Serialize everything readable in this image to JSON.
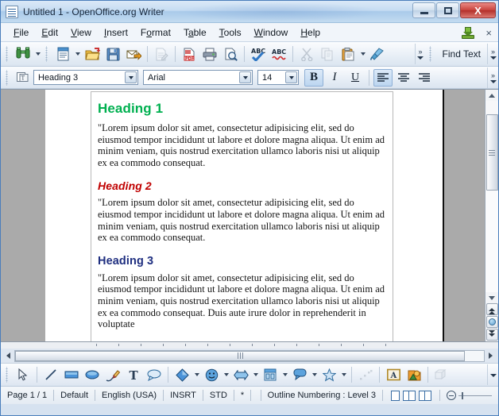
{
  "window": {
    "title": "Untitled 1 - OpenOffice.org Writer",
    "icon": "writer-document-icon",
    "minimize_label": "Minimize",
    "maximize_label": "Maximize",
    "close_label": "X"
  },
  "menubar": {
    "items": [
      {
        "label": "File",
        "accel": "F"
      },
      {
        "label": "Edit",
        "accel": "E"
      },
      {
        "label": "View",
        "accel": "V"
      },
      {
        "label": "Insert",
        "accel": "I"
      },
      {
        "label": "Format",
        "accel": "o"
      },
      {
        "label": "Table",
        "accel": "a"
      },
      {
        "label": "Tools",
        "accel": "T"
      },
      {
        "label": "Window",
        "accel": "W"
      },
      {
        "label": "Help",
        "accel": "H"
      }
    ],
    "right_icons": [
      "download-update-icon",
      "close-document-icon"
    ],
    "close_doc_label": "×"
  },
  "standard_toolbar": {
    "buttons": [
      {
        "name": "binoculars-icon",
        "tooltip": "Find & Replace"
      },
      {
        "name": "new-document-icon",
        "tooltip": "New"
      },
      {
        "name": "open-folder-icon",
        "tooltip": "Open"
      },
      {
        "name": "save-floppy-icon",
        "tooltip": "Save"
      },
      {
        "name": "email-document-icon",
        "tooltip": "E-mail Document"
      },
      {
        "name": "edit-file-icon",
        "tooltip": "Edit File"
      },
      {
        "name": "export-pdf-icon",
        "tooltip": "Export as PDF"
      },
      {
        "name": "print-icon",
        "tooltip": "Print File Directly"
      },
      {
        "name": "print-preview-icon",
        "tooltip": "Page Preview"
      },
      {
        "name": "spelling-icon",
        "tooltip": "Spelling and Grammar"
      },
      {
        "name": "autospellcheck-icon",
        "tooltip": "AutoSpellcheck"
      },
      {
        "name": "cut-scissors-icon",
        "tooltip": "Cut"
      },
      {
        "name": "copy-icon",
        "tooltip": "Copy"
      },
      {
        "name": "paste-clipboard-icon",
        "tooltip": "Paste"
      },
      {
        "name": "clone-formatting-icon",
        "tooltip": "Clone Formatting"
      }
    ],
    "overflow_label": "»",
    "find_text_label": "Find Text"
  },
  "formatting_toolbar": {
    "apply_style_icon": "apply-style-icon",
    "paragraph_style": {
      "value": "Heading 3",
      "placeholder": "Paragraph Style"
    },
    "font_name": {
      "value": "Arial",
      "placeholder": "Font Name"
    },
    "font_size": {
      "value": "14",
      "placeholder": "Font Size"
    },
    "bold": {
      "label": "B",
      "pressed": true
    },
    "italic": {
      "label": "I",
      "pressed": false
    },
    "underline": {
      "label": "U",
      "pressed": false
    },
    "align_left": {
      "name": "align-left-icon",
      "pressed": true
    },
    "align_center": {
      "name": "align-center-icon",
      "pressed": false
    },
    "align_right": {
      "name": "align-right-icon",
      "pressed": false
    },
    "overflow_label": "»"
  },
  "document": {
    "blocks": [
      {
        "heading": "Heading 1",
        "heading_color": "#00b050",
        "body": "\"Lorem ipsum dolor sit amet, consectetur adipisicing elit, sed do eiusmod tempor incididunt ut labore et dolore magna aliqua. Ut enim ad minim veniam, quis nostrud exercitation ullamco laboris nisi ut aliquip ex ea commodo consequat."
      },
      {
        "heading": "Heading 2",
        "heading_color": "#c00000",
        "body": "\"Lorem ipsum dolor sit amet, consectetur adipisicing elit, sed do eiusmod tempor incididunt ut labore et dolore magna aliqua. Ut enim ad minim veniam, quis nostrud exercitation ullamco laboris nisi ut aliquip ex ea commodo consequat."
      },
      {
        "heading": "Heading 3",
        "heading_color": "#1f2f80",
        "body": "\"Lorem ipsum dolor sit amet, consectetur adipisicing elit, sed do eiusmod tempor incididunt ut labore et dolore magna aliqua. Ut enim ad minim veniam, quis nostrud exercitation ullamco laboris nisi ut aliquip ex ea commodo consequat. Duis aute irure dolor in reprehenderit in voluptate"
      }
    ]
  },
  "drawing_toolbar": {
    "buttons": [
      {
        "name": "select-arrow-icon",
        "tooltip": "Select"
      },
      {
        "name": "line-icon",
        "tooltip": "Line"
      },
      {
        "name": "rectangle-icon",
        "tooltip": "Rectangle"
      },
      {
        "name": "ellipse-icon",
        "tooltip": "Ellipse"
      },
      {
        "name": "freeform-line-icon",
        "tooltip": "Freeform Line"
      },
      {
        "name": "text-box-icon",
        "tooltip": "Text Box"
      },
      {
        "name": "callout-icon",
        "tooltip": "Callouts"
      },
      {
        "name": "basic-shapes-icon",
        "tooltip": "Basic Shapes"
      },
      {
        "name": "symbol-shapes-icon",
        "tooltip": "Symbol Shapes"
      },
      {
        "name": "block-arrows-icon",
        "tooltip": "Block Arrows"
      },
      {
        "name": "flowchart-icon",
        "tooltip": "Flowchart"
      },
      {
        "name": "callout-shapes-icon",
        "tooltip": "Callout Shapes"
      },
      {
        "name": "stars-icon",
        "tooltip": "Stars"
      },
      {
        "name": "points-icon",
        "tooltip": "Points"
      },
      {
        "name": "fontwork-icon",
        "tooltip": "Fontwork Gallery"
      },
      {
        "name": "from-file-icon",
        "tooltip": "From File"
      },
      {
        "name": "extrusion-icon",
        "tooltip": "Extrusion On/Off"
      }
    ]
  },
  "statusbar": {
    "page": "Page 1 / 1",
    "page_style": "Default",
    "language": "English (USA)",
    "insert_mode": "INSRT",
    "selection_mode": "STD",
    "modified": "*",
    "outline": "Outline Numbering : Level 3",
    "view_layouts": [
      "single-page-view-icon",
      "multi-page-view-icon",
      "book-view-icon"
    ],
    "zoom_minus_label": "⊖"
  }
}
